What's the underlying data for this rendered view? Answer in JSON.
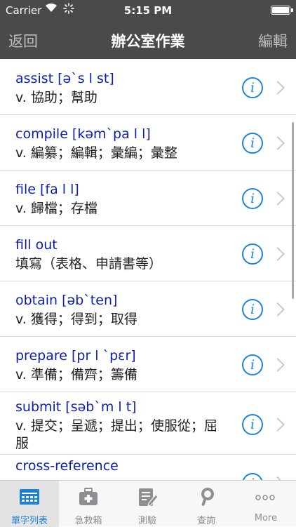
{
  "status": {
    "carrier": "Carrier",
    "time": "5:15 PM"
  },
  "nav": {
    "back": "返回",
    "title": "辦公室作業",
    "edit": "編輯"
  },
  "entries": [
    {
      "word": "assist [ə`s l st]",
      "definition": "v. 協助；幫助"
    },
    {
      "word": "compile [kəm`pa l l]",
      "definition": "v. 編纂；編輯；彙編；彙整"
    },
    {
      "word": "file [fa l l]",
      "definition": "v. 歸檔；存檔"
    },
    {
      "word": "fill out",
      "definition": "填寫（表格、申請書等）"
    },
    {
      "word": "obtain [əb`ten]",
      "definition": "v. 獲得；得到；取得"
    },
    {
      "word": "prepare [pr l `pɛr]",
      "definition": "v. 準備；備齊；籌備"
    },
    {
      "word": "submit [səb`m l t]",
      "definition": "v. 提交；呈遞；提出；使服從；屈服"
    },
    {
      "word": "cross-reference",
      "definition": ""
    }
  ],
  "tabs": [
    {
      "label": "單字列表",
      "icon": "word-list-icon"
    },
    {
      "label": "急救箱",
      "icon": "first-aid-kit-icon"
    },
    {
      "label": "測驗",
      "icon": "quiz-icon"
    },
    {
      "label": "查詢",
      "icon": "search-icon"
    },
    {
      "label": "More",
      "icon": "more-icon"
    }
  ],
  "colors": {
    "bar": "#4a4a4a",
    "word": "#0a1fb0",
    "accent": "#1a86e0"
  }
}
